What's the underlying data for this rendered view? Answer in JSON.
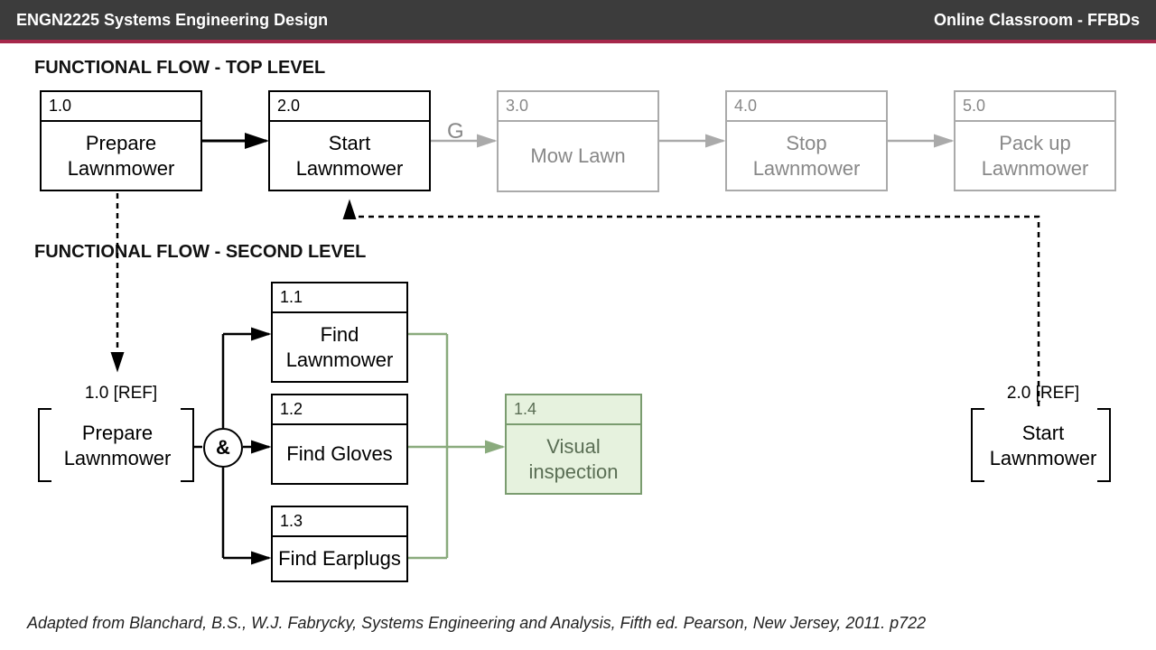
{
  "header": {
    "left": "ENGN2225 Systems Engineering Design",
    "right": "Online Classroom - FFBDs"
  },
  "sections": {
    "top": "FUNCTIONAL FLOW - TOP LEVEL",
    "second": "FUNCTIONAL FLOW - SECOND LEVEL"
  },
  "top_boxes": [
    {
      "num": "1.0",
      "label": "Prepare Lawnmower",
      "faded": false
    },
    {
      "num": "2.0",
      "label": "Start Lawnmower",
      "faded": false
    },
    {
      "num": "3.0",
      "label": "Mow Lawn",
      "faded": true
    },
    {
      "num": "4.0",
      "label": "Stop Lawnmower",
      "faded": true
    },
    {
      "num": "5.0",
      "label": "Pack up Lawnmower",
      "faded": true
    }
  ],
  "g_label": "G",
  "second_level": {
    "ref_left": {
      "tag": "1.0 [REF]",
      "label": "Prepare Lawnmower"
    },
    "and_symbol": "&",
    "branches": [
      {
        "num": "1.1",
        "label": "Find Lawnmower"
      },
      {
        "num": "1.2",
        "label": "Find Gloves"
      },
      {
        "num": "1.3",
        "label": "Find Earplugs"
      }
    ],
    "merge": {
      "num": "1.4",
      "label": "Visual inspection"
    },
    "ref_right": {
      "tag": "2.0 [REF]",
      "label": "Start Lawnmower"
    }
  },
  "citation": "Adapted from Blanchard, B.S., W.J. Fabrycky, Systems Engineering and Analysis, Fifth ed. Pearson, New Jersey, 2011. p722"
}
